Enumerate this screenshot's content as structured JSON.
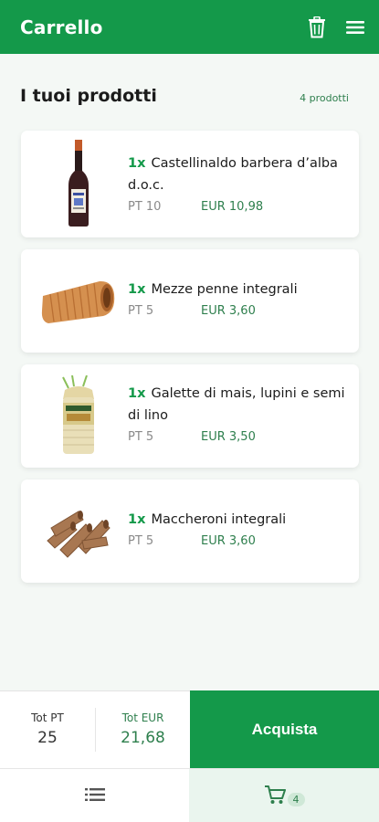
{
  "header": {
    "title": "Carrello"
  },
  "section": {
    "title": "I tuoi prodotti",
    "count": "4 prodotti"
  },
  "products": [
    {
      "qty": "1x",
      "name": "Castellinaldo barbera d’alba d.o.c.",
      "pt": "PT 10",
      "eur": "EUR 10,98",
      "image": "wine-bottle"
    },
    {
      "qty": "1x",
      "name": "Mezze penne integrali",
      "pt": "PT 5",
      "eur": "EUR 3,60",
      "image": "penne-pasta"
    },
    {
      "qty": "1x",
      "name": "Galette di mais, lupini e semi di lino",
      "pt": "PT 5",
      "eur": "EUR 3,50",
      "image": "rice-cakes-pack"
    },
    {
      "qty": "1x",
      "name": "Maccheroni integrali",
      "pt": "PT 5",
      "eur": "EUR 3,60",
      "image": "maccheroni-pasta"
    }
  ],
  "totals": {
    "pt_label": "Tot PT",
    "pt_value": "25",
    "eur_label": "Tot EUR",
    "eur_value": "21,68"
  },
  "buy_label": "Acquista",
  "tabbar": {
    "cart_badge": "4"
  },
  "colors": {
    "primary": "#14994a",
    "accent_text": "#2e7f4d",
    "background": "#f4f8f5"
  }
}
